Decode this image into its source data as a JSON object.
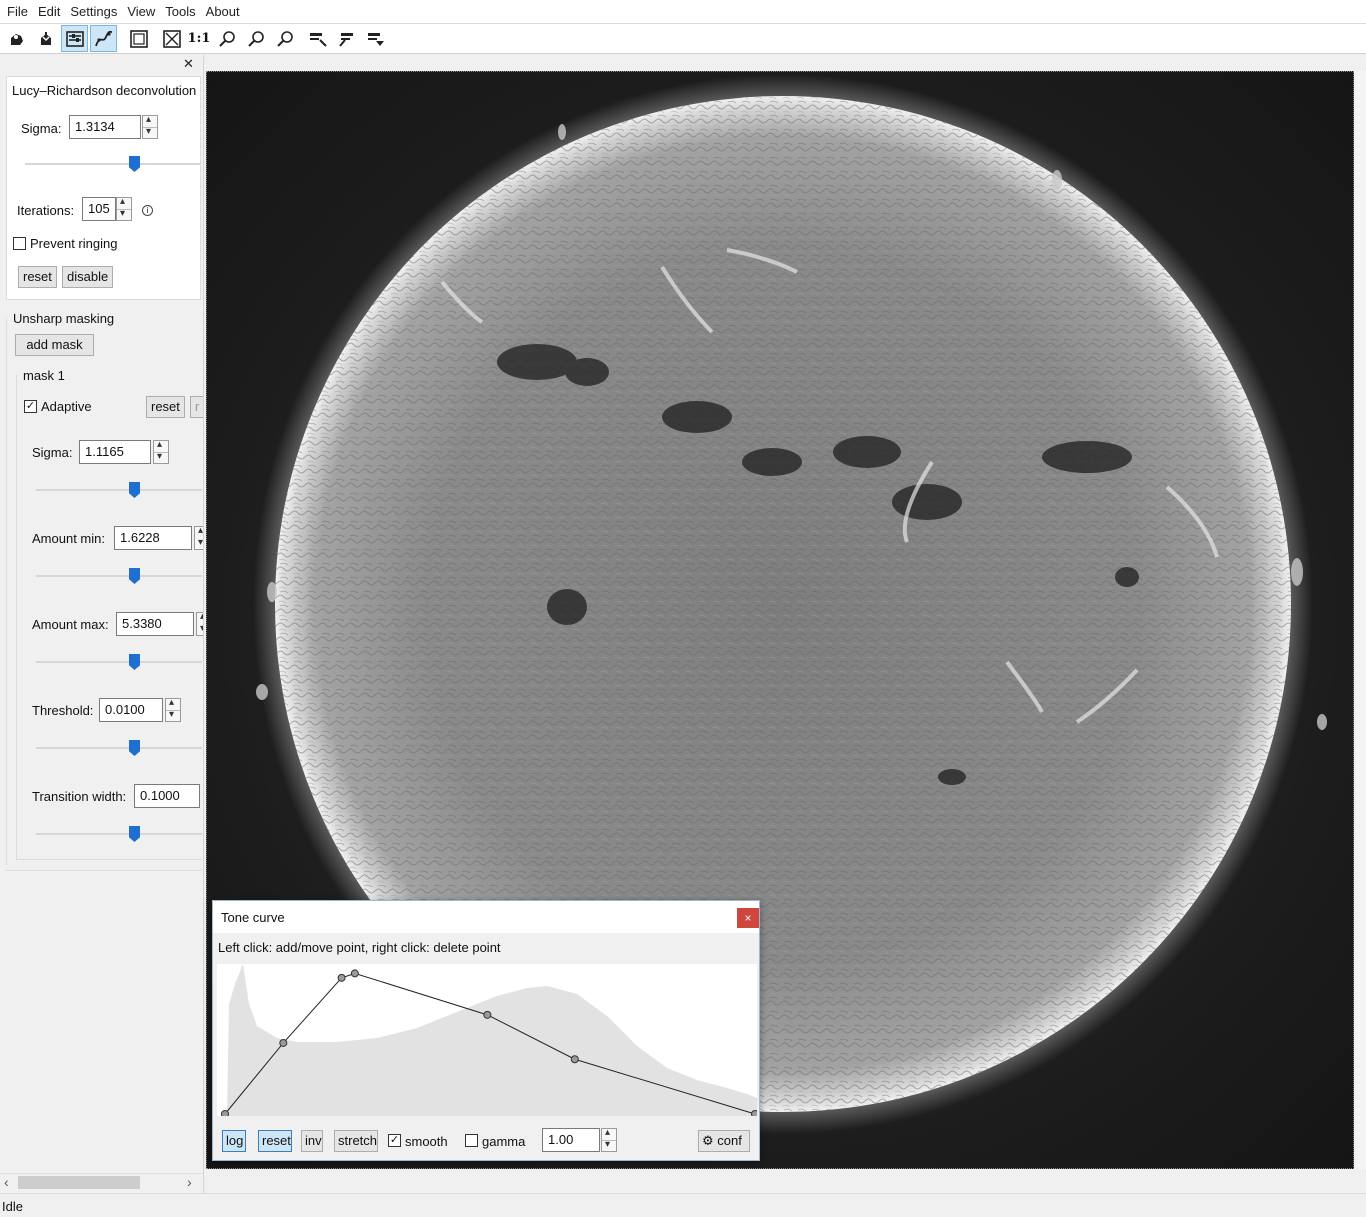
{
  "menu": [
    "File",
    "Edit",
    "Settings",
    "View",
    "Tools",
    "About"
  ],
  "toolbar": {
    "one_to_one_label": "1:1",
    "icons": [
      "open-icon",
      "save-icon",
      "align-icon",
      "curve-icon",
      "fit-icon",
      "fit-alt-icon",
      "zoom-1-1-icon",
      "zoom-in-icon",
      "zoom-out-icon",
      "zoom-fit-icon",
      "export-icon",
      "export-alt-icon",
      "dropdown-icon"
    ]
  },
  "lr": {
    "title": "Lucy–Richardson deconvolution",
    "sigma_label": "Sigma:",
    "sigma_value": "1.3134",
    "sigma_level": 0.6,
    "iterations_label": "Iterations:",
    "iterations_value": "105",
    "prevent_ringing_label": "Prevent ringing",
    "prevent_ringing_checked": false,
    "reset_label": "reset",
    "disable_label": "disable"
  },
  "usm": {
    "title": "Unsharp masking",
    "add_mask_label": "add mask",
    "mask_title": "mask 1",
    "adaptive_label": "Adaptive",
    "adaptive_checked": true,
    "reset_label": "reset",
    "sigma_label": "Sigma:",
    "sigma_value": "1.1165",
    "amount_min_label": "Amount min:",
    "amount_min_value": "1.6228",
    "amount_max_label": "Amount max:",
    "amount_max_value": "5.3380",
    "threshold_label": "Threshold:",
    "threshold_value": "0.0100",
    "transition_label": "Transition width:",
    "transition_value": "0.1000"
  },
  "status": "Idle",
  "tone": {
    "title": "Tone curve",
    "close": "×",
    "instructions": "Left click: add/move point, right click: delete point",
    "buttons": {
      "log": "log",
      "reset": "reset",
      "inv": "inv",
      "stretch": "stretch",
      "conf": "conf"
    },
    "smooth_label": "smooth",
    "smooth_checked": true,
    "gamma_label": "gamma",
    "gamma_checked": false,
    "gamma_value": "1.00",
    "curve_points": [
      [
        0.0,
        0.0
      ],
      [
        0.11,
        0.48
      ],
      [
        0.22,
        0.92
      ],
      [
        0.245,
        0.95
      ],
      [
        0.495,
        0.67
      ],
      [
        0.66,
        0.37
      ],
      [
        1.0,
        0.0
      ]
    ]
  }
}
